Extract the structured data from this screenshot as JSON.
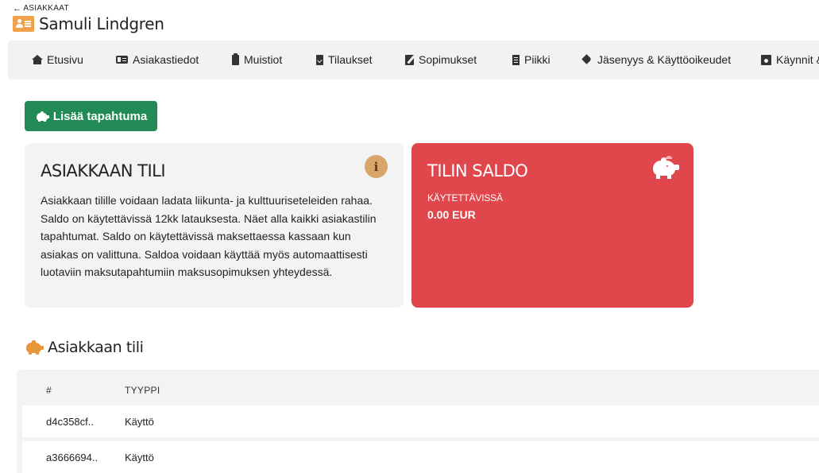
{
  "header": {
    "back_label": "ASIAKKAAT",
    "customer_name": "Samuli Lindgren"
  },
  "nav": {
    "items": [
      {
        "label": "Etusivu",
        "icon": "home-icon"
      },
      {
        "label": "Asiakastiedot",
        "icon": "id-card-icon"
      },
      {
        "label": "Muistiot",
        "icon": "clipboard-icon"
      },
      {
        "label": "Tilaukset",
        "icon": "document-check-icon"
      },
      {
        "label": "Sopimukset",
        "icon": "signature-icon"
      },
      {
        "label": "Piikki",
        "icon": "list-icon"
      },
      {
        "label": "Jäsenyys & Käyttöoikeudet",
        "icon": "tag-icon"
      },
      {
        "label": "Käynnit &",
        "icon": "calendar-icon"
      }
    ]
  },
  "actions": {
    "add_event_label": "Lisää tapahtuma"
  },
  "info_card": {
    "title": "ASIAKKAAN TILI",
    "description": "Asiakkaan tilille voidaan ladata liikunta- ja kulttuuriseteleiden rahaa. Saldo on käytettävissä 12kk latauksesta. Näet alla kaikki asiakastilin tapahtumat. Saldo on käytettävissä maksettaessa kassaan kun asiakas on valittuna. Saldoa voidaan käyttää myös automaattisesti luotaviin maksutapahtumiin maksusopimuksen yhteydessä.",
    "info_glyph": "i"
  },
  "balance_card": {
    "title": "TILIN SALDO",
    "available_label": "KÄYTETTÄVISSÄ",
    "amount": "0.00 EUR"
  },
  "account_section": {
    "title": "Asiakkaan tili",
    "columns": {
      "hash": "#",
      "type": "TYYPPI"
    },
    "rows": [
      {
        "hash": "d4c358cf..",
        "type": "Käyttö"
      },
      {
        "hash": "a3666694..",
        "type": "Käyttö"
      }
    ]
  },
  "colors": {
    "primary_button": "#228a55",
    "balance_card": "#e0474c",
    "accent_orange": "#f0a24a",
    "info_badge": "#d9a66a"
  }
}
